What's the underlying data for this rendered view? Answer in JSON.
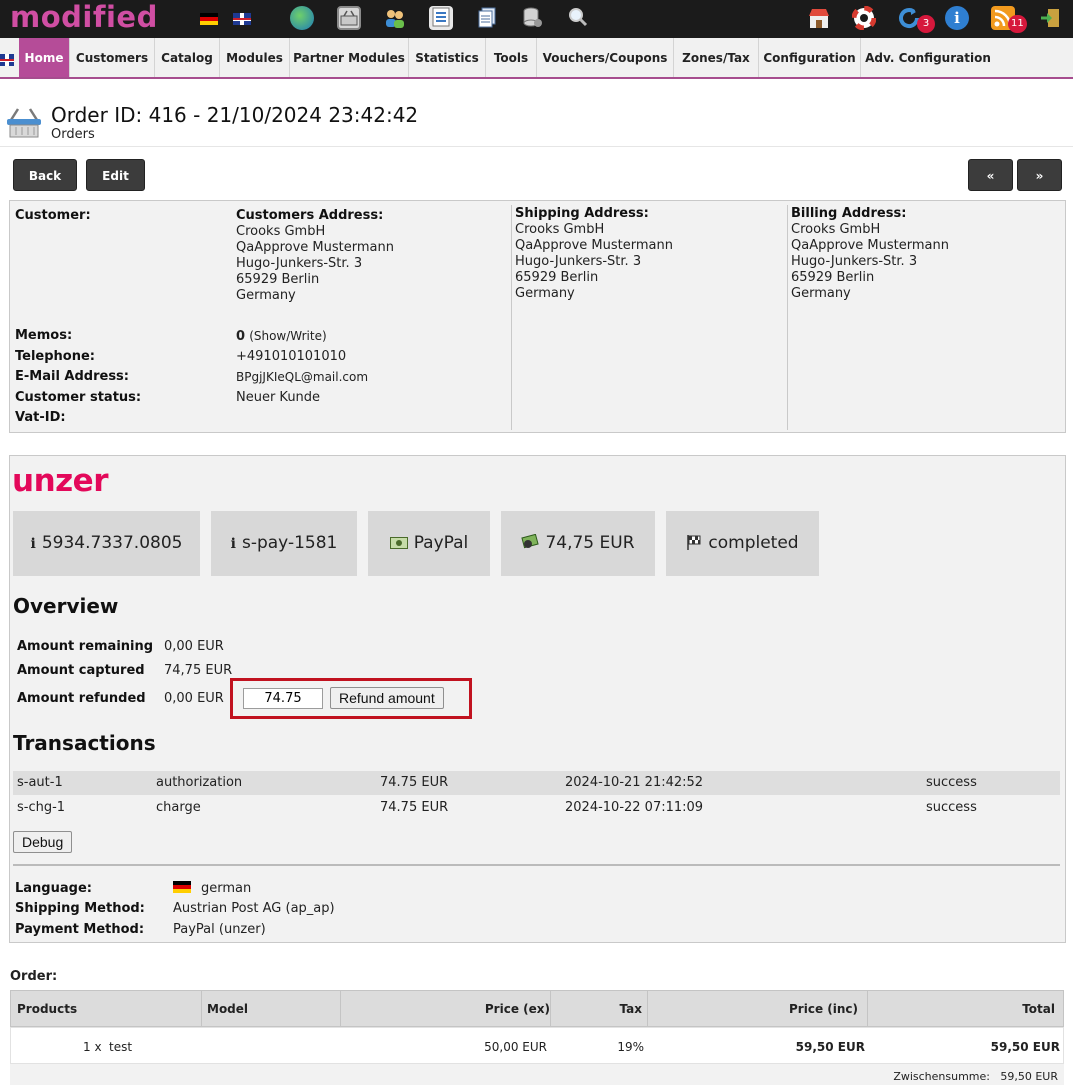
{
  "app": {
    "logo_text": "modified",
    "badges": {
      "updates": "3",
      "news": "11"
    }
  },
  "nav": {
    "items": [
      {
        "label": "Home"
      },
      {
        "label": "Customers"
      },
      {
        "label": "Catalog"
      },
      {
        "label": "Modules"
      },
      {
        "label": "Partner Modules"
      },
      {
        "label": "Statistics"
      },
      {
        "label": "Tools"
      },
      {
        "label": "Vouchers/Coupons"
      },
      {
        "label": "Zones/Tax"
      },
      {
        "label": "Configuration"
      },
      {
        "label": "Adv. Configuration"
      }
    ],
    "active": "Home"
  },
  "page": {
    "title": "Order ID: 416 - 21/10/2024 23:42:42",
    "subtitle": "Orders"
  },
  "toolbar": {
    "back": "Back",
    "edit": "Edit",
    "prev": "«",
    "next": "»"
  },
  "customer": {
    "customer_label": "Customer:",
    "customers_address_label": "Customers Address:",
    "customers_address": [
      "Crooks GmbH",
      "QaApprove Mustermann",
      "Hugo-Junkers-Str. 3",
      "65929 Berlin",
      "Germany"
    ],
    "shipping_address_label": "Shipping Address:",
    "shipping_address": [
      "Crooks GmbH",
      "QaApprove Mustermann",
      "Hugo-Junkers-Str. 3",
      "65929 Berlin",
      "Germany"
    ],
    "billing_address_label": "Billing Address:",
    "billing_address": [
      "Crooks GmbH",
      "QaApprove Mustermann",
      "Hugo-Junkers-Str. 3",
      "65929 Berlin",
      "Germany"
    ],
    "memos_label": "Memos:",
    "memos_count": "0",
    "memos_link": "(Show/Write)",
    "telephone_label": "Telephone:",
    "telephone": "+491010101010",
    "email_label": "E-Mail Address:",
    "email": "BPgjJKIeQL@mail.com",
    "status_label": "Customer status:",
    "status": "Neuer Kunde",
    "vat_label": "Vat-ID:"
  },
  "unzer": {
    "logo_text": "unzer",
    "tiles": {
      "payment_id": "5934.7337.0805",
      "short_id": "s-pay-1581",
      "method": "PayPal",
      "amount": "74,75 EUR",
      "state": "completed"
    },
    "overview_heading": "Overview",
    "remaining_label": "Amount remaining",
    "remaining": "0,00 EUR",
    "captured_label": "Amount captured",
    "captured": "74,75 EUR",
    "refunded_label": "Amount refunded",
    "refunded": "0,00 EUR",
    "refund_input": "74.75",
    "refund_button": "Refund amount",
    "transactions_heading": "Transactions",
    "transactions": [
      {
        "id": "s-aut-1",
        "type": "authorization",
        "amount": "74.75 EUR",
        "date": "2024-10-21 21:42:52",
        "status": "success"
      },
      {
        "id": "s-chg-1",
        "type": "charge",
        "amount": "74.75 EUR",
        "date": "2024-10-22 07:11:09",
        "status": "success"
      }
    ],
    "debug_button": "Debug"
  },
  "order_info": {
    "language_label": "Language:",
    "language": "german",
    "shipping_label": "Shipping Method:",
    "shipping": "Austrian Post AG (ap_ap)",
    "payment_label": "Payment Method:",
    "payment": "PayPal (unzer)"
  },
  "order": {
    "label": "Order:",
    "columns": [
      "Products",
      "Model",
      "Price (ex)",
      "Tax",
      "Price (inc)",
      "Total"
    ],
    "rows": [
      {
        "qty": "1 x",
        "name": "test",
        "model": "",
        "price_ex": "50,00 EUR",
        "tax": "19%",
        "price_inc": "59,50 EUR",
        "total": "59,50 EUR"
      }
    ],
    "subtotal_label": "Zwischensumme:",
    "subtotal": "59,50 EUR"
  }
}
